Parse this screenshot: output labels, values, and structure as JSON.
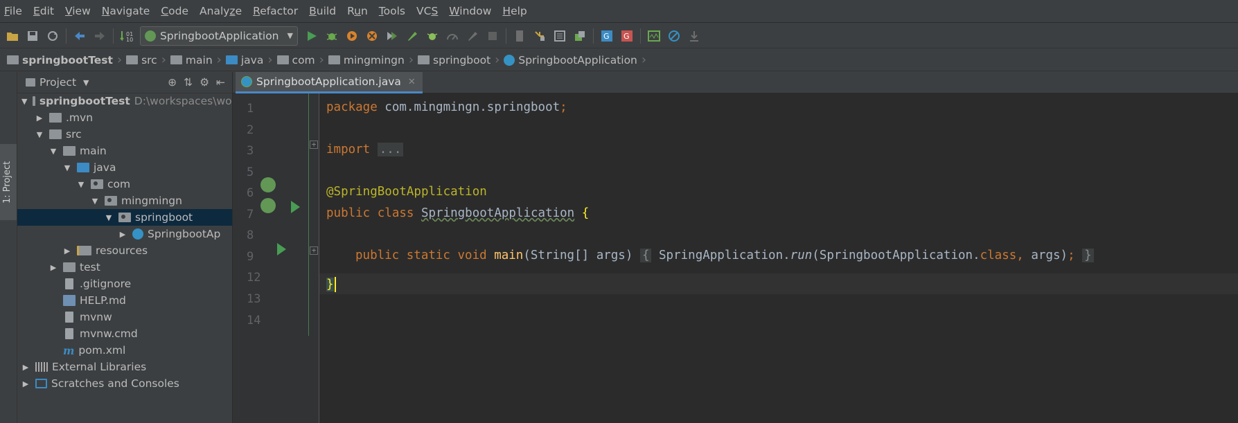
{
  "menu": [
    {
      "label": "File",
      "mnemonic": "F"
    },
    {
      "label": "Edit",
      "mnemonic": "E"
    },
    {
      "label": "View",
      "mnemonic": "V"
    },
    {
      "label": "Navigate",
      "mnemonic": "N"
    },
    {
      "label": "Code",
      "mnemonic": "C"
    },
    {
      "label": "Analyze",
      "mnemonic": "z"
    },
    {
      "label": "Refactor",
      "mnemonic": "R"
    },
    {
      "label": "Build",
      "mnemonic": "B"
    },
    {
      "label": "Run",
      "mnemonic": "u"
    },
    {
      "label": "Tools",
      "mnemonic": "T"
    },
    {
      "label": "VCS",
      "mnemonic": "S"
    },
    {
      "label": "Window",
      "mnemonic": "W"
    },
    {
      "label": "Help",
      "mnemonic": "H"
    }
  ],
  "toolbar": {
    "run_config": "SpringbootApplication"
  },
  "breadcrumb": [
    "springbootTest",
    "src",
    "main",
    "java",
    "com",
    "mingmingn",
    "springboot",
    "SpringbootApplication"
  ],
  "left_tool": {
    "project_tab": "1: Project"
  },
  "project": {
    "header": "Project",
    "root_label": "springbootTest",
    "root_path": "D:\\workspaces\\wor",
    "items": [
      ".mvn",
      "src",
      "main",
      "java",
      "com",
      "mingmingn",
      "springboot",
      "SpringbootAp",
      "resources",
      "test",
      ".gitignore",
      "HELP.md",
      "mvnw",
      "mvnw.cmd",
      "pom.xml",
      "External Libraries",
      "Scratches and Consoles"
    ]
  },
  "editor": {
    "tab_label": "SpringbootApplication.java",
    "line_numbers": [
      "1",
      "2",
      "3",
      "5",
      "6",
      "7",
      "8",
      "9",
      "12",
      "13",
      "14"
    ],
    "lines": {
      "l1_kw": "package",
      "l1_rest": " com.mingmingn.springboot",
      "l1_semi": ";",
      "l3_kw": "import",
      "l3_fold": "...",
      "l6_ann": "@SpringBootApplication",
      "l7_kw": "public class ",
      "l7_name": "SpringbootApplication",
      "l7_brace": "{",
      "l9_kw": "public static void ",
      "l9_fn": "main",
      "l9_sig": "(String[] args)",
      "l9_ob": "{",
      "l9_body1": " SpringApplication.",
      "l9_run": "run",
      "l9_body2": "(SpringbootApplication.",
      "l9_class": "class",
      "l9_comma": ",",
      "l9_args": " args)",
      "l9_semi": ";",
      "l9_cb": "}",
      "l13_brace": "}"
    }
  }
}
